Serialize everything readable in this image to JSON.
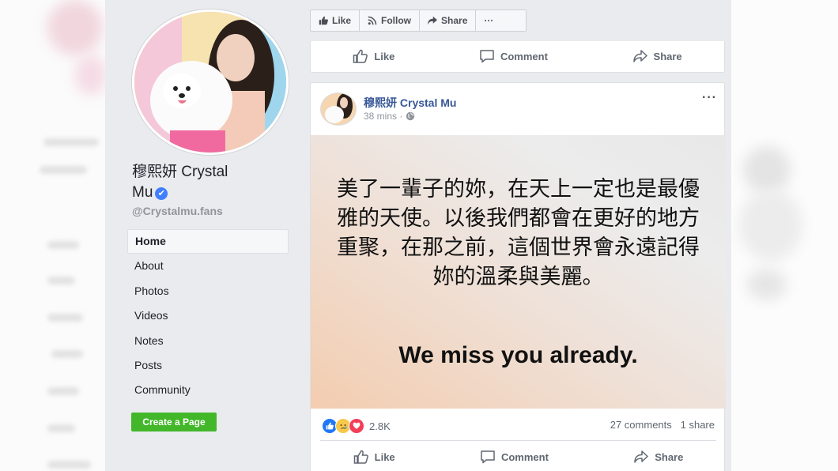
{
  "page": {
    "name": "穆熙妍 Crystal Mu",
    "name_line1": "穆熙妍 Crystal",
    "name_line2": "Mu",
    "handle": "@Crystalmu.fans"
  },
  "nav": {
    "items": [
      "Home",
      "About",
      "Photos",
      "Videos",
      "Notes",
      "Posts",
      "Community"
    ],
    "active": "Home"
  },
  "create_page_label": "Create a Page",
  "top_actions": {
    "like": "Like",
    "follow": "Follow",
    "share": "Share",
    "more": "···"
  },
  "post_actions": {
    "like": "Like",
    "comment": "Comment",
    "share": "Share"
  },
  "post": {
    "author": "穆熙妍 Crystal Mu",
    "time": "38 mins ·",
    "image_text_zh": "美了一輩子的妳，在天上一定也是最優雅的天使。以後我們都會在更好的地方重聚，在那之前，這個世界會永遠記得妳的溫柔與美麗。",
    "image_text_en": "We miss you already.",
    "reaction_count": "2.8K",
    "comments": "27 comments",
    "shares": "1 share",
    "more": "···"
  },
  "colors": {
    "facebook_blue": "#385898",
    "page_bg": "#e9ebee",
    "create_green": "#42b72a",
    "verified_blue": "#4080ff"
  },
  "icons": [
    "thumbs-up-icon",
    "rss-icon",
    "share-arrow-icon",
    "comment-icon",
    "globe-icon",
    "verified-check-icon",
    "like-reaction-icon",
    "sad-reaction-icon",
    "love-reaction-icon"
  ]
}
